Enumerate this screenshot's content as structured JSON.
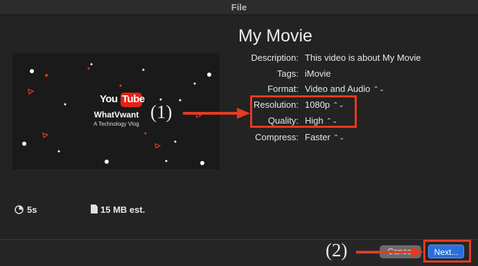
{
  "window": {
    "title": "File"
  },
  "movie": {
    "title": "My Movie"
  },
  "thumbnail": {
    "logo_you": "You",
    "logo_tube": "Tube",
    "brand": "WhatVwant",
    "tagline": "A Technology Vlog"
  },
  "fields": {
    "description": {
      "label": "Description:",
      "value": "This video is about My Movie"
    },
    "tags": {
      "label": "Tags:",
      "value": "iMovie"
    },
    "format": {
      "label": "Format:",
      "value": "Video and Audio"
    },
    "resolution": {
      "label": "Resolution:",
      "value": "1080p"
    },
    "quality": {
      "label": "Quality:",
      "value": "High"
    },
    "compress": {
      "label": "Compress:",
      "value": "Faster"
    }
  },
  "stats": {
    "duration": "5s",
    "size": "15 MB est."
  },
  "buttons": {
    "cancel": "Cancel",
    "next": "Next..."
  },
  "annotations": {
    "label1": "(1)",
    "label2": "(2)"
  },
  "colors": {
    "annotation": "#e53b22",
    "primary_button": "#2a6fdb",
    "background": "#232323"
  },
  "icons": {
    "updown": "up-down-chevron-icon",
    "duration": "clock-icon",
    "size": "file-icon"
  }
}
